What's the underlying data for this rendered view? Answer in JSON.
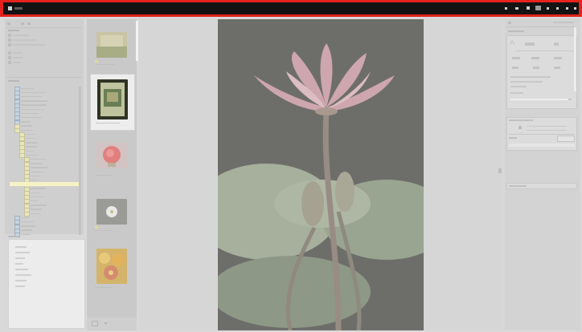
{
  "colors": {
    "top_bar_highlight": "#e4231c",
    "top_bar": "#131313",
    "background": "#d9d9d9",
    "selection": "#f5f3c4"
  },
  "topbar": {
    "app_icon": "app-logo-icon",
    "right_icons": [
      "search-icon",
      "grid-icon",
      "user-icon",
      "minimize-icon",
      "maximize-icon",
      "close-icon"
    ]
  },
  "nav": {
    "toolbar_icons": [
      "back-icon",
      "forward-icon",
      "grid-view-icon"
    ],
    "tree_rows": 36,
    "selected_row_index": 24
  },
  "filmstrip": {
    "thumbnails": [
      {
        "name": "thumb-nature-scene",
        "selected": false,
        "rated": true
      },
      {
        "name": "thumb-document-cover",
        "selected": true,
        "rated": false
      },
      {
        "name": "thumb-red-flower",
        "selected": false,
        "rated": false
      },
      {
        "name": "thumb-white-flower",
        "selected": false,
        "rated": true
      },
      {
        "name": "thumb-yellow-flowers",
        "selected": false,
        "rated": false
      }
    ]
  },
  "viewer": {
    "image": "water-lily-photo"
  },
  "inspector": {
    "sections": [
      "histogram",
      "adjustments",
      "keywords"
    ]
  }
}
